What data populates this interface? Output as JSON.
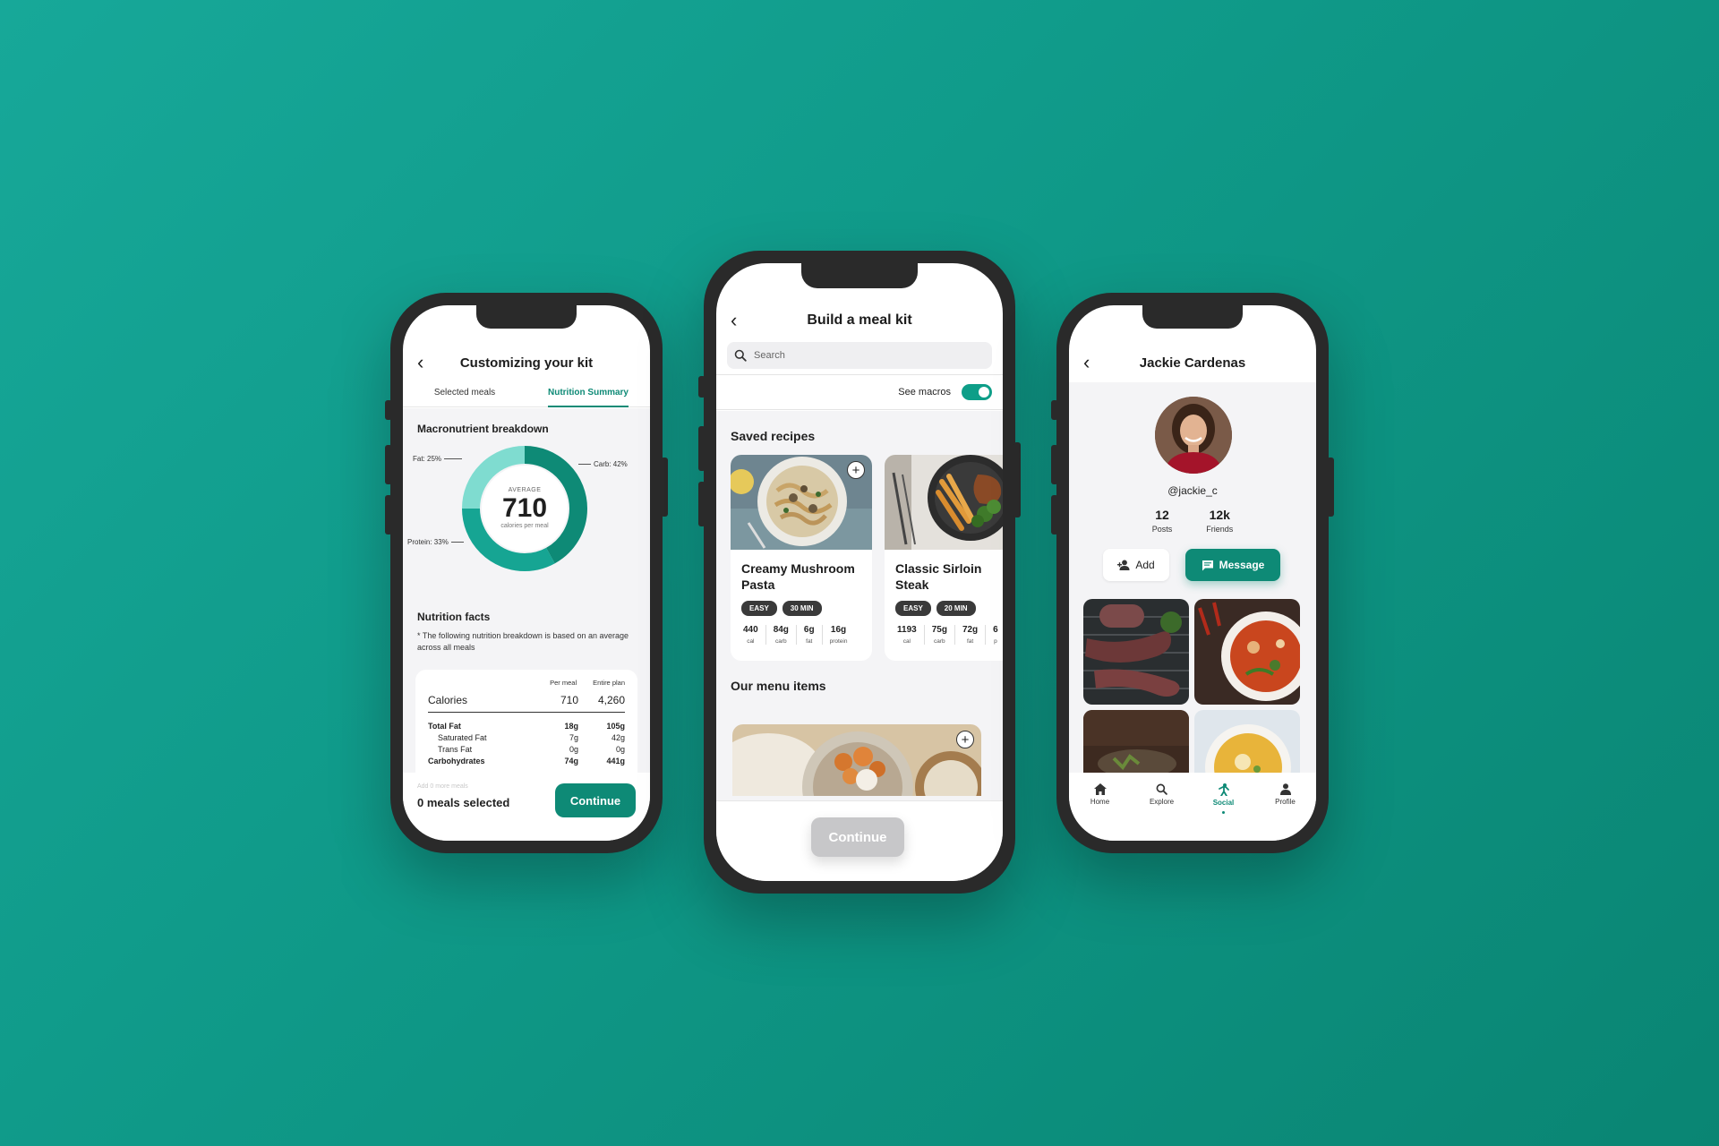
{
  "colors": {
    "accent": "#0e8a76",
    "background": "#13a08f",
    "chip": "#3a3a3a",
    "disabled_button": "#c7c7c9"
  },
  "phone1": {
    "title": "Customizing your kit",
    "tabs": [
      "Selected meals",
      "Nutrition Summary"
    ],
    "active_tab": "Nutrition Summary",
    "macro_title": "Macronutrient breakdown",
    "donut": {
      "top_label": "AVERAGE",
      "value": "710",
      "sub_label": "calories per meal",
      "segments": [
        {
          "label": "Fat: 25%",
          "percent": 25,
          "color": "#7fdcd0"
        },
        {
          "label": "Carb: 42%",
          "percent": 42,
          "color": "#0e8a76"
        },
        {
          "label": "Protein: 33%",
          "percent": 33,
          "color": "#16a593"
        }
      ]
    },
    "nutrition_title": "Nutrition facts",
    "note": "* The following nutrition breakdown is based on an average across all meals",
    "table": {
      "headers": [
        "Per meal",
        "Entire plan"
      ],
      "calories": {
        "label": "Calories",
        "per_meal": "710",
        "entire": "4,260"
      },
      "rows": [
        {
          "label": "Total Fat",
          "per_meal": "18g",
          "entire": "105g",
          "bold": true
        },
        {
          "label": "Saturated Fat",
          "per_meal": "7g",
          "entire": "42g",
          "bold": false
        },
        {
          "label": "Trans Fat",
          "per_meal": "0g",
          "entire": "0g",
          "bold": false
        },
        {
          "label": "Carbohydrates",
          "per_meal": "74g",
          "entire": "441g",
          "bold": true
        }
      ]
    },
    "footer": {
      "hint": "Add 0 more meals",
      "count": "0 meals selected",
      "button": "Continue"
    }
  },
  "phone2": {
    "title": "Build a meal kit",
    "search_placeholder": "Search",
    "macros_label": "See macros",
    "macros_on": true,
    "saved_title": "Saved recipes",
    "recipes": [
      {
        "name": "Creamy Mushroom Pasta",
        "chips": [
          "EASY",
          "30 MIN"
        ],
        "macros": [
          {
            "value": "440",
            "label": "cal"
          },
          {
            "value": "84g",
            "label": "carb"
          },
          {
            "value": "6g",
            "label": "fat"
          },
          {
            "value": "16g",
            "label": "protein"
          }
        ]
      },
      {
        "name": "Classic Sirloin Steak",
        "chips": [
          "EASY",
          "20 MIN"
        ],
        "macros": [
          {
            "value": "1193",
            "label": "cal"
          },
          {
            "value": "75g",
            "label": "carb"
          },
          {
            "value": "72g",
            "label": "fat"
          },
          {
            "value": "6",
            "label": "p"
          }
        ]
      }
    ],
    "menu_title": "Our menu items",
    "footer_button": "Continue"
  },
  "phone3": {
    "title": "Jackie Cardenas",
    "handle": "@jackie_c",
    "stats": [
      {
        "value": "12",
        "label": "Posts"
      },
      {
        "value": "12k",
        "label": "Friends"
      }
    ],
    "add_label": "Add",
    "message_label": "Message",
    "tabs": [
      {
        "label": "Home",
        "icon": "home-icon"
      },
      {
        "label": "Explore",
        "icon": "search-icon"
      },
      {
        "label": "Social",
        "icon": "social-icon"
      },
      {
        "label": "Profile",
        "icon": "person-icon"
      }
    ],
    "active_tab": "Social"
  }
}
